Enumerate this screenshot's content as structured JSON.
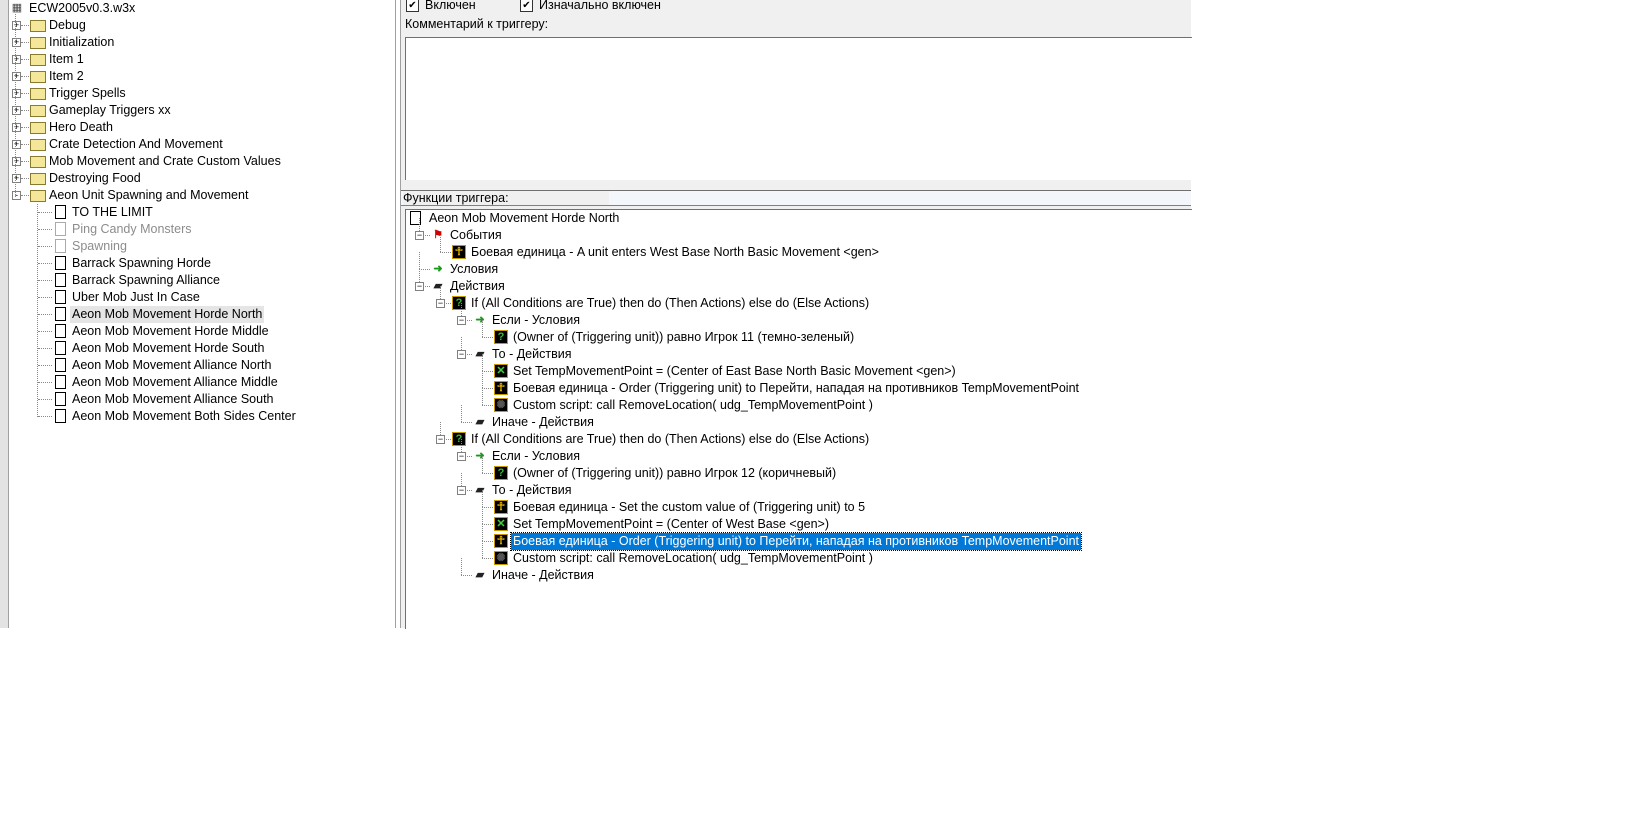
{
  "left_tree": {
    "root": "ECW2005v0.3.w3x",
    "folders": [
      "Debug",
      "Initialization",
      "Item 1",
      "Item 2",
      "Trigger Spells",
      "Gameplay Triggers xx",
      "Hero Death",
      "Crate Detection And Movement",
      "Mob Movement and Crate Custom Values",
      "Destroying Food"
    ],
    "open_folder": "Aeon Unit Spawning and Movement",
    "triggers": [
      {
        "label": "TO THE LIMIT",
        "disabled": false
      },
      {
        "label": "Ping Candy Monsters",
        "disabled": true
      },
      {
        "label": "Spawning",
        "disabled": true
      },
      {
        "label": "Barrack Spawning Horde",
        "disabled": false
      },
      {
        "label": "Barrack Spawning Alliance",
        "disabled": false
      },
      {
        "label": "Uber Mob Just In Case",
        "disabled": false
      },
      {
        "label": "Aeon Mob Movement Horde North",
        "disabled": false,
        "selected": true
      },
      {
        "label": "Aeon Mob Movement Horde Middle",
        "disabled": false
      },
      {
        "label": "Aeon Mob Movement Horde South",
        "disabled": false
      },
      {
        "label": "Aeon Mob Movement Alliance North",
        "disabled": false
      },
      {
        "label": "Aeon Mob Movement Alliance Middle",
        "disabled": false
      },
      {
        "label": "Aeon Mob Movement Alliance South",
        "disabled": false
      },
      {
        "label": "Aeon Mob Movement Both Sides Center",
        "disabled": false
      }
    ]
  },
  "options": {
    "enabled_label": "Включен",
    "enabled": true,
    "initially_on_label": "Изначально включен",
    "initially_on": true,
    "comment_label": "Комментарий к триггеру:",
    "comment": ""
  },
  "functions": {
    "label": "Функции триггера:",
    "items": [
      {
        "level": 0,
        "icon": "doc",
        "text": "Aeon Mob Movement Horde North"
      },
      {
        "level": 1,
        "icon": "flag",
        "text": "События",
        "exp": "-"
      },
      {
        "level": 2,
        "icon": "unit",
        "text": "Боевая единица - A unit enters West Base North Basic Movement <gen>"
      },
      {
        "level": 1,
        "icon": "cond",
        "text": "Условия"
      },
      {
        "level": 1,
        "icon": "action",
        "text": "Действия",
        "exp": "-"
      },
      {
        "level": 2,
        "icon": "question",
        "text": "If (All Conditions are True) then do (Then Actions) else do (Else Actions)",
        "exp": "-"
      },
      {
        "level": 3,
        "icon": "cond",
        "text": "Если - Условия",
        "exp": "-"
      },
      {
        "level": 4,
        "icon": "question",
        "text": "(Owner of (Triggering unit)) равно Игрок 11 (темно-зеленый)"
      },
      {
        "level": 3,
        "icon": "action",
        "text": "То - Действия",
        "exp": "-"
      },
      {
        "level": 4,
        "icon": "variable",
        "text": "Set TempMovementPoint = (Center of East Base North Basic Movement <gen>)"
      },
      {
        "level": 4,
        "icon": "unit",
        "text": "Боевая единица - Order (Triggering unit) to Перейти, нападая на противников TempMovementPoint"
      },
      {
        "level": 4,
        "icon": "script",
        "text": "Custom script:   call RemoveLocation( udg_TempMovementPoint )"
      },
      {
        "level": 3,
        "icon": "action",
        "text": "Иначе - Действия"
      },
      {
        "level": 2,
        "icon": "question",
        "text": "If (All Conditions are True) then do (Then Actions) else do (Else Actions)",
        "exp": "-"
      },
      {
        "level": 3,
        "icon": "cond",
        "text": "Если - Условия",
        "exp": "-"
      },
      {
        "level": 4,
        "icon": "question",
        "text": "(Owner of (Triggering unit)) равно Игрок 12 (коричневый)"
      },
      {
        "level": 3,
        "icon": "action",
        "text": "То - Действия",
        "exp": "-"
      },
      {
        "level": 4,
        "icon": "unit",
        "text": "Боевая единица - Set the custom value of (Triggering unit) to 5"
      },
      {
        "level": 4,
        "icon": "variable",
        "text": "Set TempMovementPoint = (Center of West Base <gen>)"
      },
      {
        "level": 4,
        "icon": "unit",
        "text": "Боевая единица - Order (Triggering unit) to Перейти, нападая на противников TempMovementPoint",
        "selected": true
      },
      {
        "level": 4,
        "icon": "script",
        "text": "Custom script:   call RemoveLocation( udg_TempMovementPoint )"
      },
      {
        "level": 3,
        "icon": "action",
        "text": "Иначе - Действия"
      }
    ]
  }
}
